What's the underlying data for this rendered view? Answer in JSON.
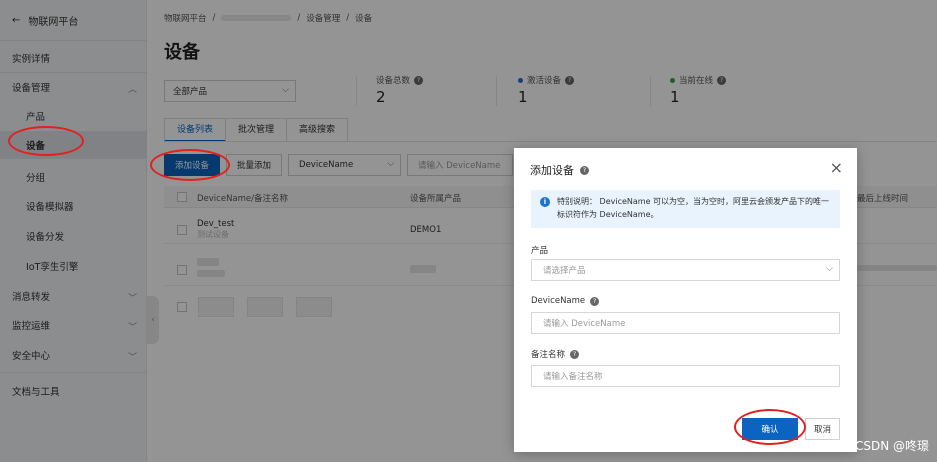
{
  "sidebar": {
    "back_label": "物联网平台",
    "items": [
      {
        "label": "实例详情"
      },
      {
        "label": "设备管理"
      },
      {
        "label": "产品"
      },
      {
        "label": "设备"
      },
      {
        "label": "分组"
      },
      {
        "label": "设备模拟器"
      },
      {
        "label": "设备分发"
      },
      {
        "label": "IoT孪生引擎"
      },
      {
        "label": "消息转发"
      },
      {
        "label": "监控运维"
      },
      {
        "label": "安全中心"
      },
      {
        "label": "文档与工具"
      }
    ]
  },
  "breadcrumb": [
    "物联网平台",
    "设备管理",
    "设备"
  ],
  "page_title": "设备",
  "product_filter": {
    "value": "全部产品"
  },
  "stats": [
    {
      "label": "设备总数",
      "value": "2"
    },
    {
      "label": "激活设备",
      "value": "1",
      "dot_color": "#1a73d0"
    },
    {
      "label": "当前在线",
      "value": "1",
      "dot_color": "#2eaa44"
    }
  ],
  "tabs": [
    {
      "label": "设备列表",
      "active": true
    },
    {
      "label": "批次管理"
    },
    {
      "label": "高级搜索"
    }
  ],
  "toolbar": {
    "add_label": "添加设备",
    "batch_label": "批量添加",
    "filter_field": "DeviceName",
    "search_placeholder": "请输入 DeviceName"
  },
  "table": {
    "headers": [
      "DeviceName/备注名称",
      "设备所属产品",
      "最后上线时间"
    ],
    "rows": [
      {
        "name": "Dev_test",
        "note": "测试设备",
        "product": "DEMO1"
      }
    ]
  },
  "modal": {
    "title": "添加设备",
    "close": "×",
    "notice": "特别说明： DeviceName 可以为空，当为空时，阿里云会颁发产品下的唯一标识符作为 DeviceName。",
    "product_label": "产品",
    "product_placeholder": "请选择产品",
    "devicename_label": "DeviceName",
    "devicename_placeholder": "请输入 DeviceName",
    "note_label": "备注名称",
    "note_placeholder": "请输入备注名称",
    "confirm": "确认",
    "cancel": "取消"
  },
  "watermark": "CSDN @咚璟",
  "colors": {
    "primary": "#0c64c0",
    "highlight_ring": "#e0221f"
  }
}
